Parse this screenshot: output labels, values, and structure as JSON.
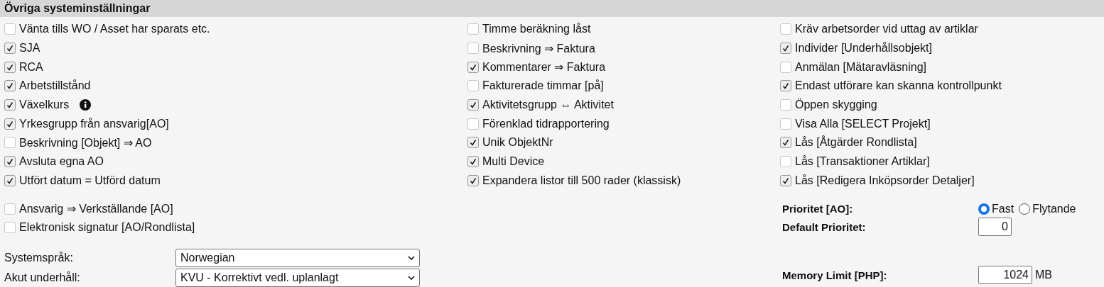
{
  "section": {
    "title": "Övriga systeminställningar"
  },
  "columns": [
    [
      {
        "label": "Vänta tills WO / Asset har sparats etc.",
        "checked": false,
        "info": false
      },
      {
        "label": "SJA",
        "checked": true,
        "info": false
      },
      {
        "label": "RCA",
        "checked": true,
        "info": false
      },
      {
        "label": "Arbetstillstånd",
        "checked": true,
        "info": false
      },
      {
        "label": "Växelkurs",
        "checked": true,
        "info": true
      },
      {
        "label": "Yrkesgrupp från ansvarig[AO]",
        "checked": true,
        "info": false
      },
      {
        "label": "Beskrivning [Objekt] ⇒ AO",
        "checked": false,
        "info": false
      },
      {
        "label": "Avsluta egna AO",
        "checked": true,
        "info": false
      },
      {
        "label": "Utfört datum = Utförd datum",
        "checked": true,
        "info": false
      }
    ],
    [
      {
        "label": "Timme beräkning låst",
        "checked": false,
        "info": false
      },
      {
        "label": "Beskrivning ⇒ Faktura",
        "checked": false,
        "info": false
      },
      {
        "label": "Kommentarer ⇒ Faktura",
        "checked": true,
        "info": false
      },
      {
        "label": "Fakturerade timmar [på]",
        "checked": false,
        "info": false
      },
      {
        "label": "Aktivitetsgrupp ⇔ Aktivitet",
        "checked": true,
        "info": false
      },
      {
        "label": "Förenklad tidrapportering",
        "checked": false,
        "info": false
      },
      {
        "label": "Unik ObjektNr",
        "checked": true,
        "info": false
      },
      {
        "label": "Multi Device",
        "checked": true,
        "info": false
      },
      {
        "label": "Expandera listor till 500 rader (klassisk)",
        "checked": true,
        "info": false
      }
    ],
    [
      {
        "label": "Kräv arbetsorder vid uttag av artiklar",
        "checked": false,
        "info": false
      },
      {
        "label": "Individer [Underhållsobjekt]",
        "checked": true,
        "info": false
      },
      {
        "label": "Anmälan [Mätaravläsning]",
        "checked": false,
        "info": false
      },
      {
        "label": "Endast utförare kan skanna kontrollpunkt",
        "checked": true,
        "info": false
      },
      {
        "label": "Öppen skygging",
        "checked": false,
        "info": false
      },
      {
        "label": "Visa Alla [SELECT Projekt]",
        "checked": false,
        "info": false
      },
      {
        "label": "Lås [Åtgärder Rondlista]",
        "checked": true,
        "info": false
      },
      {
        "label": "Lås [Transaktioner Artiklar]",
        "checked": false,
        "info": false
      },
      {
        "label": "Lås [Redigera Inköpsorder Detaljer]",
        "checked": true,
        "info": false
      }
    ]
  ],
  "extra_checkboxes": [
    {
      "label": "Ansvarig ⇒ Verkställande [AO]",
      "checked": false
    },
    {
      "label": "Elektronisk signatur [AO/Rondlista]",
      "checked": false
    }
  ],
  "dropdowns": [
    {
      "label": "Systemspråk:",
      "value": "Norwegian"
    },
    {
      "label": "Akut underhåll:",
      "value": "KVU - Korrektivt vedl. uplanlagt"
    }
  ],
  "priority": {
    "label": "Prioritet [AO]:",
    "options": [
      {
        "label": "Fast",
        "selected": true
      },
      {
        "label": "Flytande",
        "selected": false
      }
    ]
  },
  "default_priority": {
    "label": "Default Prioritet:",
    "value": "0"
  },
  "memory_limit": {
    "label": "Memory Limit [PHP]:",
    "value": "1024",
    "unit": "MB"
  }
}
